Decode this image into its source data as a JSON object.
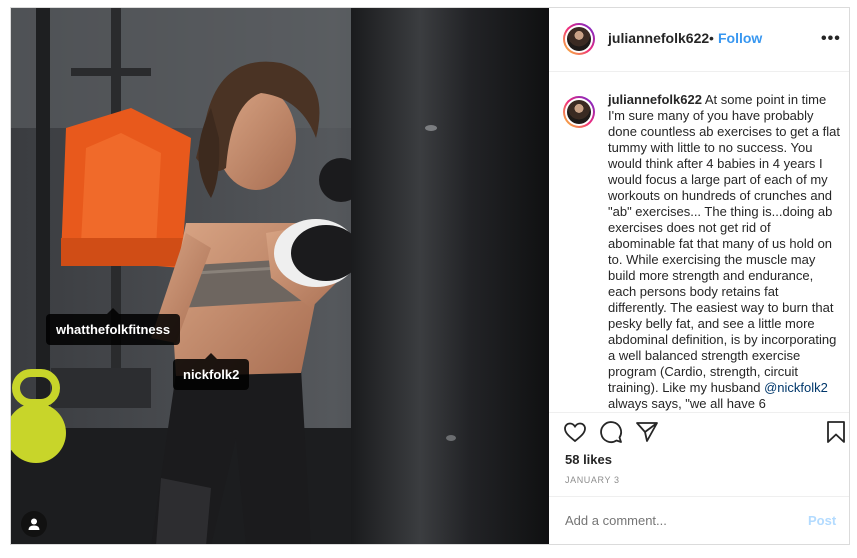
{
  "post": {
    "username": "juliannefolk622",
    "follow_separator": "•",
    "follow_label": "Follow",
    "more_label": "•••",
    "caption": {
      "username": "juliannefolk622",
      "text_before_mention": "At some point in time I'm sure many of you have probably done countless ab exercises to get a flat tummy with little to no success. You would think after 4 babies in 4 years I would focus a large part of each of my workouts on hundreds of crunches and \"ab\" exercises... The thing is...doing ab exercises does not get rid of abominable fat that many of us hold on to. While exercising the muscle may build more strength and endurance, each persons body retains fat differently. The easiest way to burn that pesky belly fat, and see a little more abdominal definition, is by incorporating a well balanced strength exercise program (Cardio, strength, circuit training). Like my husband",
      "mention": "@nickfolk2",
      "text_after_mention": "always says, \"we all have 6"
    },
    "likes": "58 likes",
    "date": "JANUARY 3",
    "comment_placeholder": "Add a comment...",
    "post_label": "Post"
  },
  "photo": {
    "tags": [
      {
        "username": "whatthefolkfitness"
      },
      {
        "username": "nickfolk2"
      }
    ]
  },
  "icons": {
    "like": "heart-icon",
    "comment": "comment-icon",
    "share": "share-icon",
    "save": "bookmark-icon",
    "user_tags": "person-icon",
    "more": "more-icon"
  },
  "colors": {
    "link": "#3897f0",
    "text": "#262626",
    "muted": "#8e8e8e",
    "post_disabled": "#b3dbff"
  }
}
